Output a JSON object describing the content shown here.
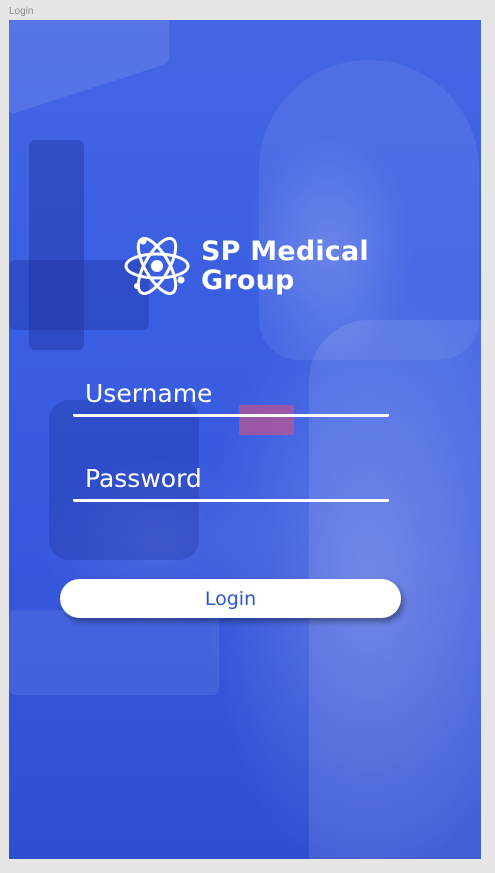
{
  "artboard": {
    "label": "Login"
  },
  "brand": {
    "line1": "SP Medical",
    "line2": "Group",
    "icon": "atom-icon"
  },
  "form": {
    "username_placeholder": "Username",
    "password_placeholder": "Password",
    "login_label": "Login"
  },
  "colors": {
    "overlay_blue": "#3b5bdb",
    "button_text": "#2f55d4",
    "button_bg": "#ffffff",
    "text_light": "#ffffff"
  }
}
